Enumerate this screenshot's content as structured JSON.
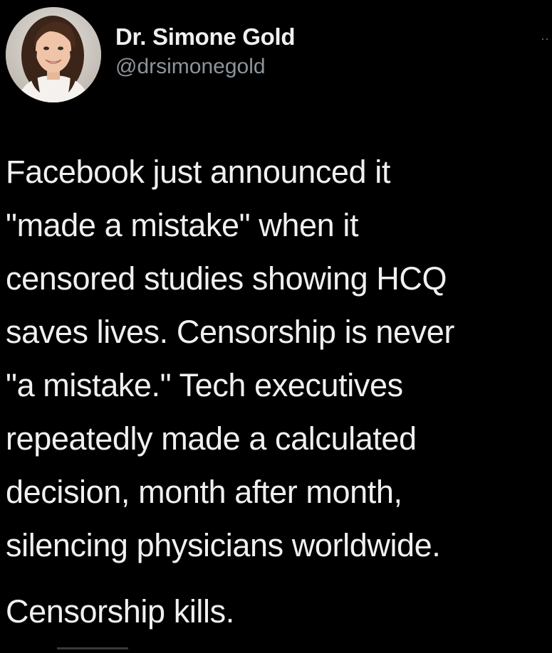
{
  "tweet": {
    "author": {
      "display_name": "Dr. Simone Gold",
      "handle": "@drsimonegold",
      "avatar": "profile-photo"
    },
    "more_icon": "ellipsis-icon",
    "body_lines": [
      "Facebook just announced it",
      "\"made a mistake\" when it",
      "censored studies showing HCQ",
      "saves lives. Censorship is never",
      "\"a mistake.\"  Tech executives",
      "repeatedly made a calculated",
      "decision, month after month,",
      "silencing physicians worldwide."
    ],
    "closing": "Censorship kills."
  },
  "colors": {
    "background": "#000000",
    "text": "#f0f0f0",
    "handle": "#8c949b"
  }
}
